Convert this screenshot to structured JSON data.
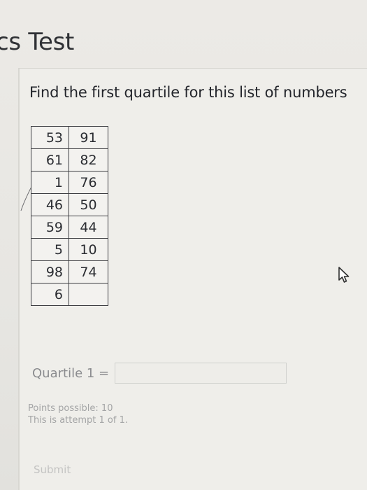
{
  "header": {
    "title": "cs Test"
  },
  "question": {
    "prompt": "Find the first quartile for this list of numbers",
    "numbers_table": [
      [
        "53",
        "91"
      ],
      [
        "61",
        "82"
      ],
      [
        "1",
        "76"
      ],
      [
        "46",
        "50"
      ],
      [
        "59",
        "44"
      ],
      [
        "5",
        "10"
      ],
      [
        "98",
        "74"
      ],
      [
        "6",
        ""
      ]
    ],
    "answer_label": "Quartile 1 =",
    "answer_value": "",
    "points_possible": "Points possible: 10",
    "attempt": "This is attempt 1 of 1.",
    "submit_label": "Submit"
  },
  "icons": {
    "cursor": "mouse-pointer-icon"
  }
}
